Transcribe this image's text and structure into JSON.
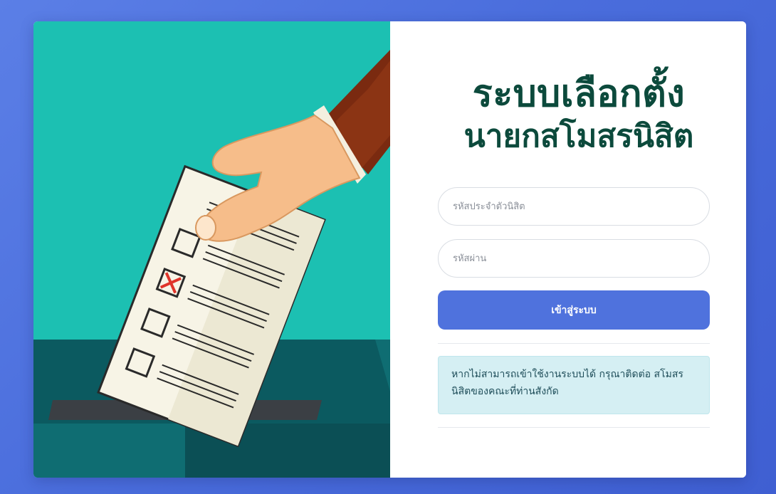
{
  "title": {
    "line1": "ระบบเลือกตั้ง",
    "line2": "นายกสโมสรนิสิต"
  },
  "login_form": {
    "student_id_placeholder": "รหัสประจำตัวนิสิต",
    "password_placeholder": "รหัสผ่าน",
    "submit_label": "เข้าสู่ระบบ"
  },
  "notice": {
    "text": "หากไม่สามารถเข้าใช้งานระบบได้ กรุณาติดต่อ สโมสรนิสิตของคณะที่ท่านสังกัด"
  },
  "colors": {
    "page_background": "#4a6ddc",
    "illustration_background": "#1cc0b2",
    "title": "#0c4a3c",
    "button": "#4f72dd",
    "notice_background": "#d5eff3"
  },
  "icons": {
    "illustration": "hand-placing-ballot-illustration"
  }
}
